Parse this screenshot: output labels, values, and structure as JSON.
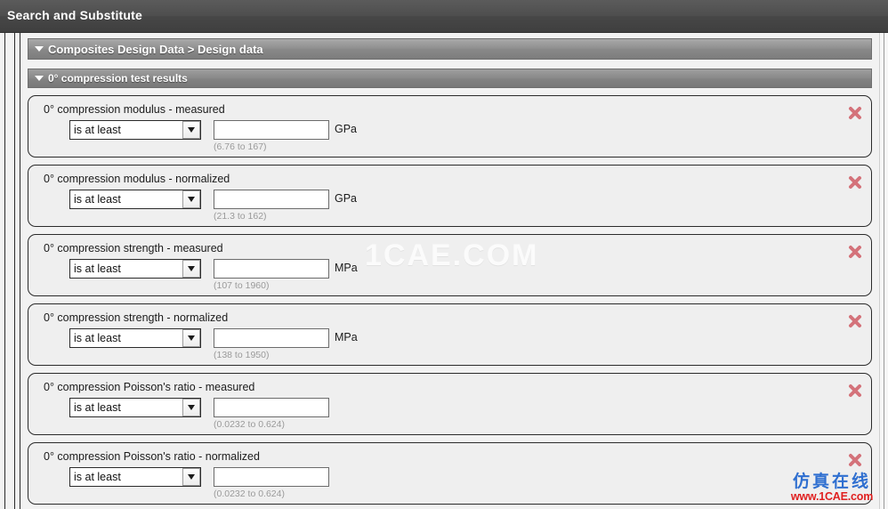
{
  "window": {
    "title": "Search and Substitute"
  },
  "breadcrumb": {
    "label": "Composites Design Data > Design data",
    "caret_icon": "caret-down-icon"
  },
  "section": {
    "label": "0° compression test results",
    "caret_icon": "caret-down-icon"
  },
  "icons": {
    "dropdown": "chevron-down-icon",
    "remove": "close-x-icon"
  },
  "criteria": [
    {
      "title": "0° compression modulus - measured",
      "operator": "is at least",
      "value": "",
      "value_placeholder": "",
      "unit": "GPa",
      "range_hint": "(6.76 to 167)"
    },
    {
      "title": "0° compression modulus - normalized",
      "operator": "is at least",
      "value": "",
      "value_placeholder": "",
      "unit": "GPa",
      "range_hint": "(21.3 to 162)"
    },
    {
      "title": "0° compression strength - measured",
      "operator": "is at least",
      "value": "",
      "value_placeholder": "",
      "unit": "MPa",
      "range_hint": "(107 to 1960)"
    },
    {
      "title": "0° compression strength - normalized",
      "operator": "is at least",
      "value": "",
      "value_placeholder": "",
      "unit": "MPa",
      "range_hint": "(138 to 1950)"
    },
    {
      "title": "0° compression Poisson's ratio - measured",
      "operator": "is at least",
      "value": "",
      "value_placeholder": "",
      "unit": "",
      "range_hint": "(0.0232 to 0.624)"
    },
    {
      "title": "0° compression Poisson's ratio - normalized",
      "operator": "is at least",
      "value": "",
      "value_placeholder": "",
      "unit": "",
      "range_hint": "(0.0232 to 0.624)"
    }
  ],
  "watermark": {
    "text": "1CAE.COM"
  },
  "logo": {
    "chinese": "仿真在线",
    "url": "www.1CAE.com"
  },
  "colors": {
    "titlebar": "#4a4a4a",
    "group_header": "#8a8a8a",
    "card_bg": "#efefef",
    "remove_icon": "#d4727a",
    "logo_blue": "#2f6fd0",
    "logo_red": "#e02020"
  }
}
